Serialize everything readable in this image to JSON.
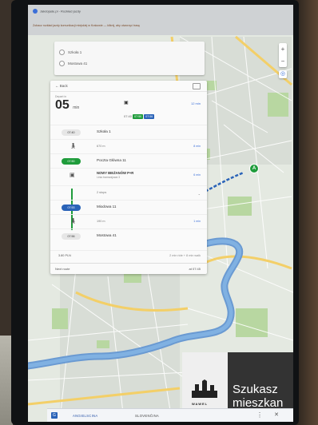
{
  "browser": {
    "tab_title": "Jakdojade.pl - Rozkład jazdy",
    "url_notice": "Zobacz rozkład jazdy komunikacji miejskiej w Krakowie — kliknij, aby otworzyć trasę"
  },
  "stops": {
    "from": "Szkoła 1",
    "to": "Mostowa 41"
  },
  "panel": {
    "back_label": "← Back",
    "depart_small": "Depart in",
    "depart_value": "05",
    "depart_unit": "min",
    "summary_time": "07:40",
    "summary_chip_1": "07:50",
    "summary_chip_2": "07:56",
    "total_time": "12 min",
    "legs": [
      {
        "time": "07:40",
        "name": "Szkoła 1"
      },
      {
        "info": "670 m",
        "link": "8 min"
      },
      {
        "time": "07:50",
        "name": "Poczta Główna 11"
      },
      {
        "line": "NOWY BIEŻANÓW P+R",
        "sub": "Linia tramwajowa 3",
        "link": "6 min"
      },
      {
        "stops_label": "2 stops",
        "expand": "⌄"
      },
      {
        "time": "07:53",
        "name": "Miodowa 11"
      },
      {
        "info": "190 m",
        "link": "1 min"
      },
      {
        "time": "07:56",
        "name": "Mostowa 41"
      }
    ],
    "price": "3.80 PLN",
    "summary_footer": "2 min ride + 8 min walk",
    "bottom_label": "Next route",
    "bottom_time": "at 07:45"
  },
  "ad": {
    "brand": "WAWEL",
    "text_1": "Szukasz",
    "text_2": "mieszkan"
  },
  "bottom_bar": {
    "lang_1": "ANGIELSCINA",
    "lang_2": "SLOVENČINA"
  },
  "map": {
    "marker_label": "A"
  }
}
